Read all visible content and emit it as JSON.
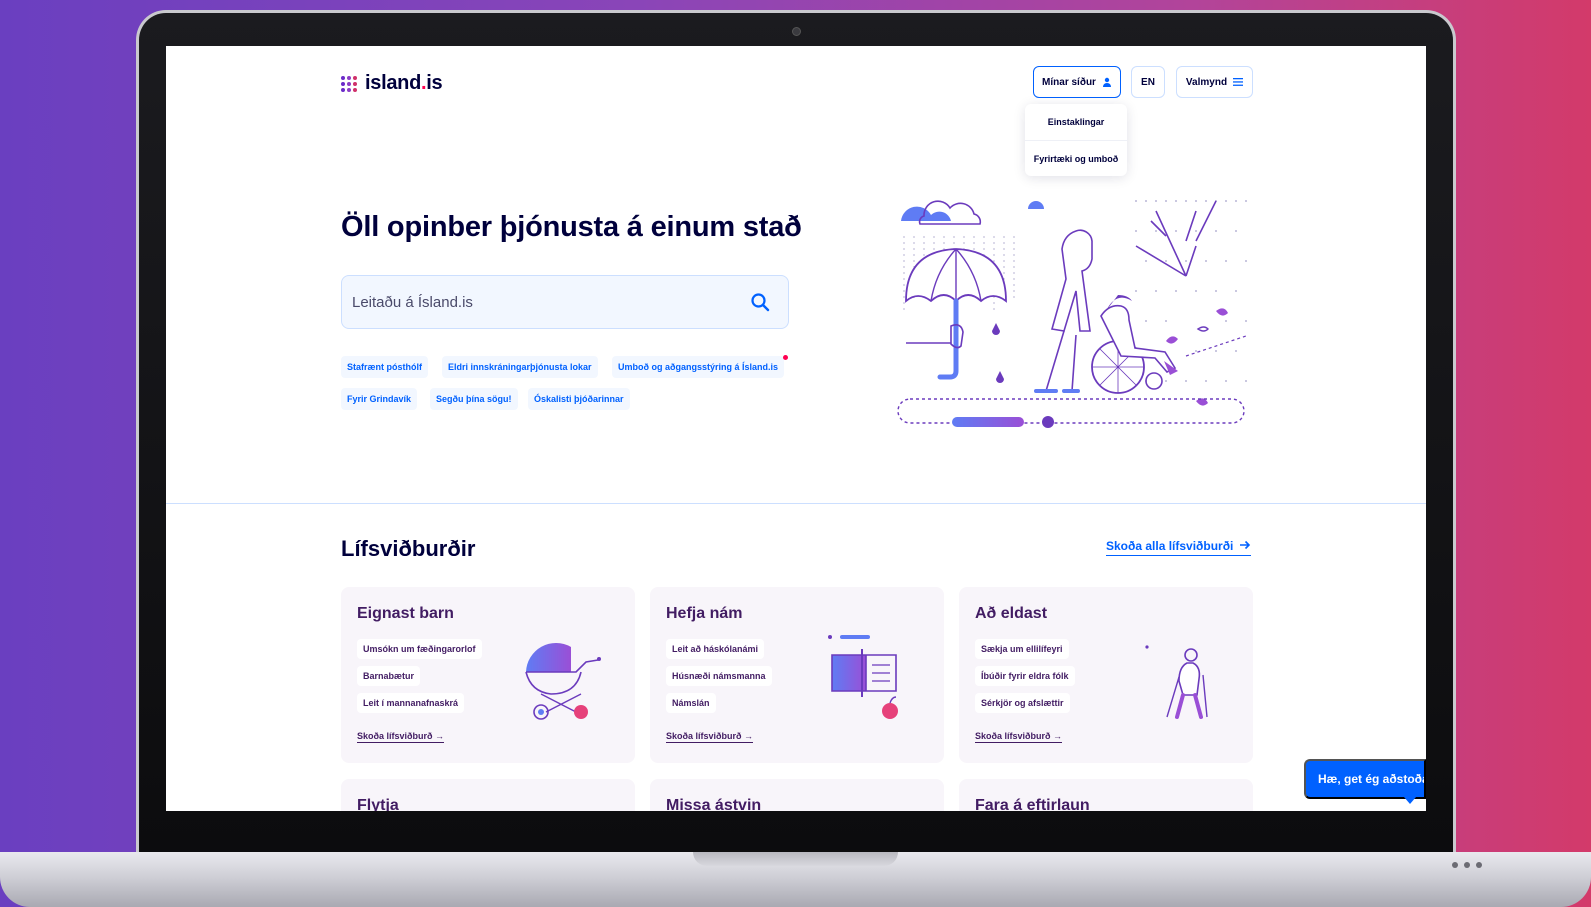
{
  "brand": {
    "logo_text_main": "island",
    "logo_text_dot": ".",
    "logo_text_tld": "is"
  },
  "header": {
    "my_pages_label": "Mínar síður",
    "lang_label": "EN",
    "menu_label": "Valmynd"
  },
  "my_pages_menu": {
    "items": [
      "Einstaklingar",
      "Fyrirtæki og umboð"
    ]
  },
  "hero": {
    "title": "Öll opinber þjónusta á einum stað",
    "search_placeholder": "Leitaðu á Ísland.is",
    "chips_row1": [
      "Stafrænt pósthólf",
      "Eldri innskráningarþjónusta lokar",
      "Umboð og aðgangsstýring á Ísland.is"
    ],
    "chips_row2": [
      "Fyrir Grindavík",
      "Segðu þína sögu!",
      "Óskalisti þjóðarinnar"
    ]
  },
  "life_events": {
    "title": "Lífsviðburðir",
    "see_all": "Skoða alla lífsviðburði",
    "cards": [
      {
        "title": "Eignast barn",
        "tags": [
          "Umsókn um fæðingarorlof",
          "Barnabætur",
          "Leit í mannanafnaskrá"
        ],
        "link": "Skoða lífsviðburð"
      },
      {
        "title": "Hefja nám",
        "tags": [
          "Leit að háskólanámi",
          "Húsnæði námsmanna",
          "Námslán"
        ],
        "link": "Skoða lífsviðburð"
      },
      {
        "title": "Að eldast",
        "tags": [
          "Sækja um ellilífeyri",
          "Íbúðir fyrir eldra fólk",
          "Sérkjör og afslættir"
        ],
        "link": "Skoða lífsviðburð"
      }
    ],
    "cards_row2": [
      "Flytja",
      "Missa ástvin",
      "Fara á eftirlaun"
    ]
  },
  "chat": {
    "label": "Hæ, get ég aðstoðað?"
  },
  "colors": {
    "primary": "#0061ff",
    "navy": "#00003c",
    "purple": "#421c63",
    "accent": "#ff0050"
  },
  "icons": {
    "search": "search-icon",
    "user": "user-icon",
    "menu": "hamburger-icon",
    "arrow": "arrow-right-icon"
  }
}
